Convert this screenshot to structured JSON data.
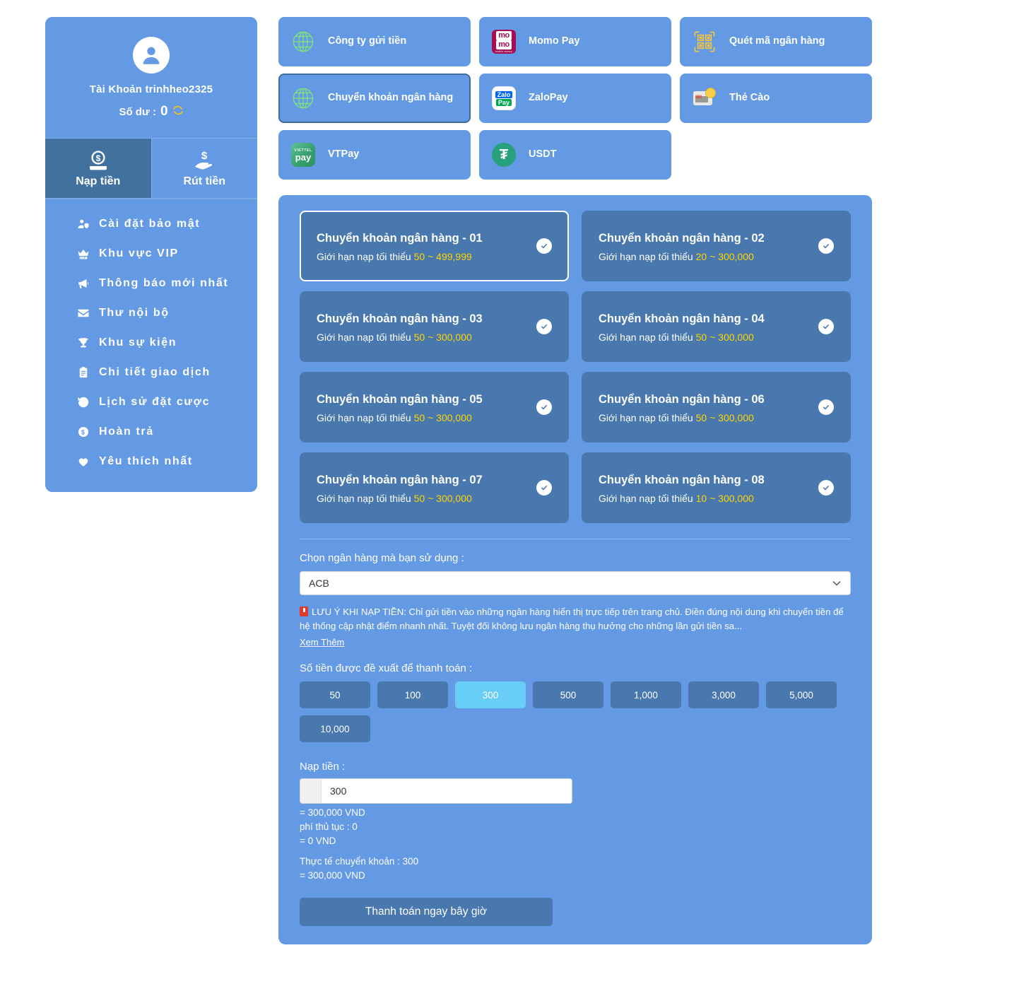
{
  "sidebar": {
    "account_label": "Tài Khoản trinhheo2325",
    "balance_label": "Số dư :",
    "balance_value": "0",
    "tabs": [
      {
        "label": "Nạp tiền",
        "icon": "deposit-coin-icon",
        "active": true
      },
      {
        "label": "Rút tiền",
        "icon": "withdraw-hand-icon",
        "active": false
      }
    ],
    "items": [
      {
        "label": "Cài đặt bảo mật",
        "icon": "user-shield-icon"
      },
      {
        "label": "Khu vực VIP",
        "icon": "crown-vip-icon"
      },
      {
        "label": "Thông báo mới nhất",
        "icon": "megaphone-icon"
      },
      {
        "label": "Thư nội bộ",
        "icon": "envelope-icon"
      },
      {
        "label": "Khu sự kiện",
        "icon": "trophy-icon"
      },
      {
        "label": "Chi tiết giao dịch",
        "icon": "clipboard-icon"
      },
      {
        "label": "Lịch sử đặt cược",
        "icon": "history-clock-icon"
      },
      {
        "label": "Hoàn trả",
        "icon": "dollar-circle-icon"
      },
      {
        "label": "Yêu thích nhất",
        "icon": "heart-icon"
      }
    ]
  },
  "methods": [
    {
      "label": "Công ty gửi tiền",
      "icon": "globe-icon",
      "selected": false
    },
    {
      "label": "Momo Pay",
      "icon": "momo-logo-icon",
      "selected": false
    },
    {
      "label": "Quét mã ngân hàng",
      "icon": "qr-code-icon",
      "selected": false
    },
    {
      "label": "Chuyển khoản ngân hàng",
      "icon": "globe-icon",
      "selected": true
    },
    {
      "label": "ZaloPay",
      "icon": "zalopay-logo-icon",
      "selected": false
    },
    {
      "label": "Thẻ Cào",
      "icon": "scratch-card-icon",
      "selected": false
    },
    {
      "label": "VTPay",
      "icon": "viettelpay-logo-icon",
      "selected": false
    },
    {
      "label": "USDT",
      "icon": "usdt-logo-icon",
      "selected": false
    }
  ],
  "banks": {
    "limit_prefix": "Giới hạn nạp tối thiểu",
    "cards": [
      {
        "title": "Chuyển khoản ngân hàng - 01",
        "min": "50",
        "max": "499,999",
        "selected": true
      },
      {
        "title": "Chuyển khoản ngân hàng - 02",
        "min": "20",
        "max": "300,000",
        "selected": false
      },
      {
        "title": "Chuyển khoản ngân hàng - 03",
        "min": "50",
        "max": "300,000",
        "selected": false
      },
      {
        "title": "Chuyển khoản ngân hàng - 04",
        "min": "50",
        "max": "300,000",
        "selected": false
      },
      {
        "title": "Chuyển khoản ngân hàng - 05",
        "min": "50",
        "max": "300,000",
        "selected": false
      },
      {
        "title": "Chuyển khoản ngân hàng - 06",
        "min": "50",
        "max": "300,000",
        "selected": false
      },
      {
        "title": "Chuyển khoản ngân hàng - 07",
        "min": "50",
        "max": "300,000",
        "selected": false
      },
      {
        "title": "Chuyển khoản ngân hàng - 08",
        "min": "10",
        "max": "300,000",
        "selected": false
      }
    ]
  },
  "form": {
    "bank_select_label": "Chọn ngân hàng mà bạn sử dụng :",
    "bank_select_value": "ACB",
    "bank_select_options": [
      "ACB"
    ],
    "notice_text": "LƯU Ý KHI NẠP TIỀN: Chỉ gửi tiền vào những ngân hàng hiển thị trực tiếp trên trang chủ. Điền đúng nội dung khi chuyển tiền để hệ thống cập nhật điểm nhanh nhất. Tuyệt đối không lưu ngân hàng thụ hưởng cho những lần gửi tiền sa...",
    "notice_more": "Xem Thêm",
    "suggest_label": "Số tiền được đề xuất để thanh toán :",
    "suggest_amounts": [
      "50",
      "100",
      "300",
      "500",
      "1,000",
      "3,000",
      "5,000",
      "10,000"
    ],
    "suggest_active": "300",
    "amount_label": "Nạp tiền :",
    "amount_value": "300",
    "amount_vnd": "= 300,000 VND",
    "fee_label": "phí thủ tục :  0",
    "fee_vnd": "= 0 VND",
    "actual_label": "Thực tế chuyển khoản :  300",
    "actual_vnd": "= 300,000 VND",
    "submit_label": "Thanh toán ngay bây giờ"
  },
  "colors": {
    "panel_blue": "#6499e4",
    "card_blue": "#4878ad",
    "accent_yellow": "#ffd400",
    "chip_active": "#68cdf7"
  }
}
